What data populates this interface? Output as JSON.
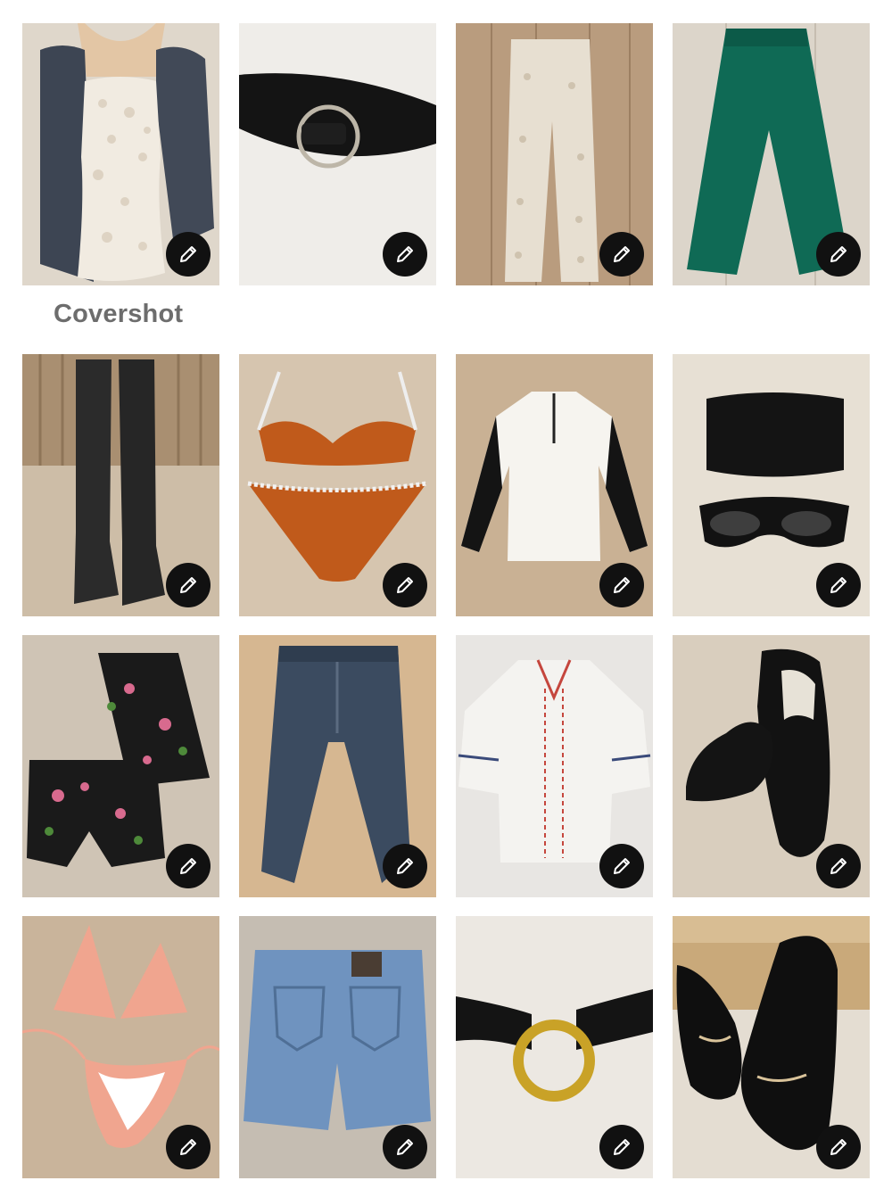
{
  "grid": {
    "cover_label": "Covershot",
    "items": [
      {
        "id": "lace-romper",
        "icon": "lace-romper-photo",
        "colors": {
          "bg": "#e8e1d8",
          "main": "#efe9df",
          "accent": "#3f4652"
        }
      },
      {
        "id": "black-ring-belt",
        "icon": "ring-belt-photo",
        "colors": {
          "bg": "#eeece8",
          "main": "#151515",
          "accent": "#b9b3a6"
        }
      },
      {
        "id": "crochet-pants",
        "icon": "crochet-pants-photo",
        "colors": {
          "bg": "#b79a7c",
          "main": "#e6ded0",
          "accent": "#a98a6a"
        }
      },
      {
        "id": "green-wide-pants",
        "icon": "green-pants-photo",
        "colors": {
          "bg": "#d9d2c6",
          "main": "#0f6a55",
          "accent": "#c9c1b4"
        }
      },
      {
        "id": "suede-boots",
        "icon": "black-boots-photo",
        "colors": {
          "bg": "#cbbba4",
          "main": "#2a2a2a",
          "accent": "#a58d72"
        }
      },
      {
        "id": "orange-bikini",
        "icon": "orange-bikini-photo",
        "colors": {
          "bg": "#d5c4ae",
          "main": "#c05a1b",
          "accent": "#f4f4f4"
        }
      },
      {
        "id": "polo-quarter-zip",
        "icon": "quarter-zip-photo",
        "colors": {
          "bg": "#c9b194",
          "main": "#f6f4ef",
          "accent": "#141414"
        }
      },
      {
        "id": "sunglasses-case",
        "icon": "sunglasses-photo",
        "colors": {
          "bg": "#e6dfd3",
          "main": "#121212",
          "accent": "#444444"
        }
      },
      {
        "id": "floral-pajama-set",
        "icon": "floral-set-photo",
        "colors": {
          "bg": "#cfc4b5",
          "main": "#1a1a1a",
          "accent": "#d86a8e"
        }
      },
      {
        "id": "barrel-jeans",
        "icon": "barrel-jeans-photo",
        "colors": {
          "bg": "#d6b791",
          "main": "#3b4b60",
          "accent": "#5b6b80"
        }
      },
      {
        "id": "embroidered-blouse",
        "icon": "embroidered-blouse-photo",
        "colors": {
          "bg": "#e7e5e2",
          "main": "#f3f2ef",
          "accent": "#c5463d"
        }
      },
      {
        "id": "velvet-loafers",
        "icon": "black-loafers-photo",
        "colors": {
          "bg": "#d8cdbd",
          "main": "#121212",
          "accent": "#b8a88f"
        }
      },
      {
        "id": "peach-bikini",
        "icon": "peach-bikini-photo",
        "colors": {
          "bg": "#c9b49b",
          "main": "#f0a58f",
          "accent": "#ffffff"
        }
      },
      {
        "id": "denim-shorts",
        "icon": "denim-shorts-photo",
        "colors": {
          "bg": "#c4bcb1",
          "main": "#6f93bf",
          "accent": "#4f6f96"
        }
      },
      {
        "id": "gold-ring-belt",
        "icon": "gold-ring-belt-photo",
        "colors": {
          "bg": "#ebe7e1",
          "main": "#141414",
          "accent": "#c9a227"
        }
      },
      {
        "id": "charm-heels",
        "icon": "charm-heels-photo",
        "colors": {
          "bg": "#e4ddd2",
          "main": "#0f0f0f",
          "accent": "#c9a97a"
        }
      }
    ],
    "edit_icon": "pencil-icon"
  }
}
